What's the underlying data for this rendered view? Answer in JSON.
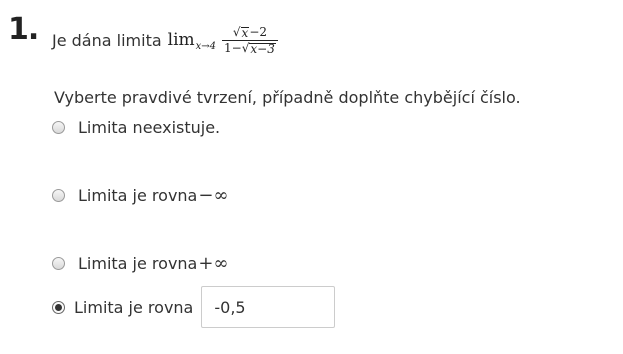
{
  "question": {
    "number": "1.",
    "intro": "Je dána limita",
    "lim_word": "lim",
    "lim_sub": "x→4",
    "numerator_radicand": "x",
    "numerator_rest": "−2",
    "denominator_lead": "1−",
    "denominator_radicand": "x−3",
    "instruction": "Vyberte pravdivé tvrzení, případně doplňte chybějící číslo."
  },
  "options": [
    {
      "label": "Limita neexistuje.",
      "symbol": "",
      "checked": false
    },
    {
      "label": "Limita je rovna",
      "symbol": "−∞",
      "checked": false
    },
    {
      "label": "Limita je rovna",
      "symbol": "+∞",
      "checked": false
    },
    {
      "label": "Limita je rovna",
      "symbol": "",
      "checked": true
    }
  ],
  "answer_value": "-0,5"
}
